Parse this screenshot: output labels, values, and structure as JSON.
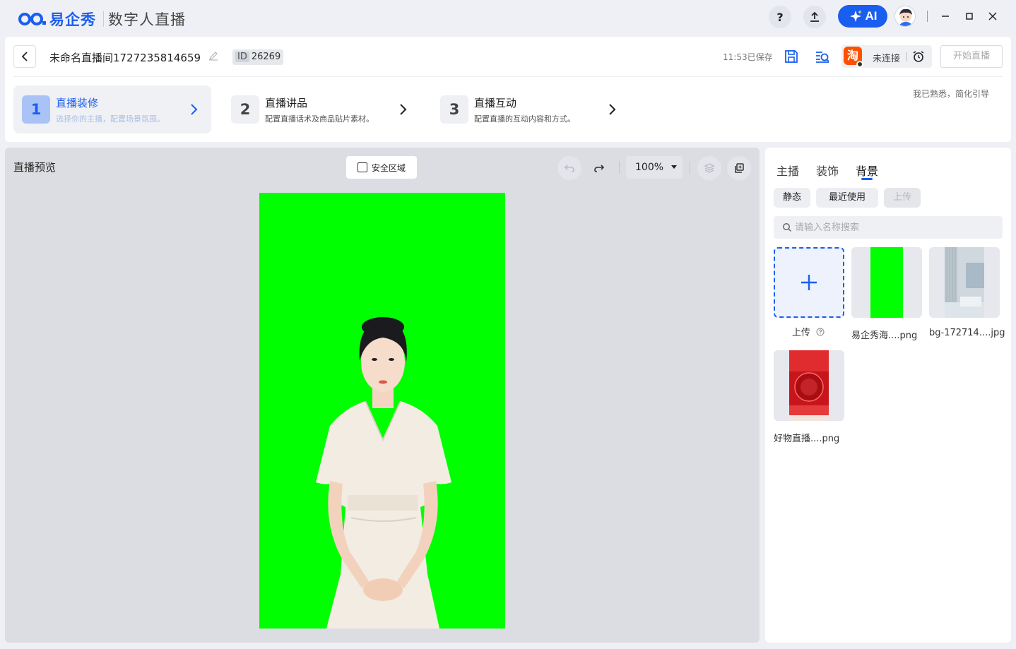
{
  "app": {
    "brand": "易企秀",
    "product": "数字人直播",
    "help_label": "?",
    "ai_label": "AI"
  },
  "header": {
    "title": "未命名直播间1727235814659",
    "id_key": "ID",
    "id_value": "26269",
    "saved_text": "11:53已保存",
    "platform_icon_text": "淘",
    "connection_status": "未连接",
    "start_button": "开始直播",
    "simplify_link": "我已熟悉，简化引导"
  },
  "steps": [
    {
      "number": "1",
      "title": "直播装修",
      "desc": "选择你的主播，配置场景氛围。"
    },
    {
      "number": "2",
      "title": "直播讲品",
      "desc": "配置直播话术及商品贴片素材。"
    },
    {
      "number": "3",
      "title": "直播互动",
      "desc": "配置直播的互动内容和方式。"
    }
  ],
  "preview": {
    "title": "直播预览",
    "safe_zone_label": "安全区域",
    "safe_zone_checked": false,
    "zoom": "100%",
    "canvas_color": "#00ff00"
  },
  "panel": {
    "tabs": [
      "主播",
      "装饰",
      "背景"
    ],
    "active_tab": "背景",
    "filters": [
      "静态",
      "最近使用",
      "上传"
    ],
    "search_placeholder": "请输入名称搜索",
    "upload_label": "上传",
    "assets": [
      {
        "label": "易企秀海....png"
      },
      {
        "label": "bg-172714....jpg"
      },
      {
        "label": "好物直播....png"
      }
    ]
  },
  "colors": {
    "accent": "#1a5ef0",
    "green_screen": "#00ff00",
    "taobao": "#ff5000"
  }
}
